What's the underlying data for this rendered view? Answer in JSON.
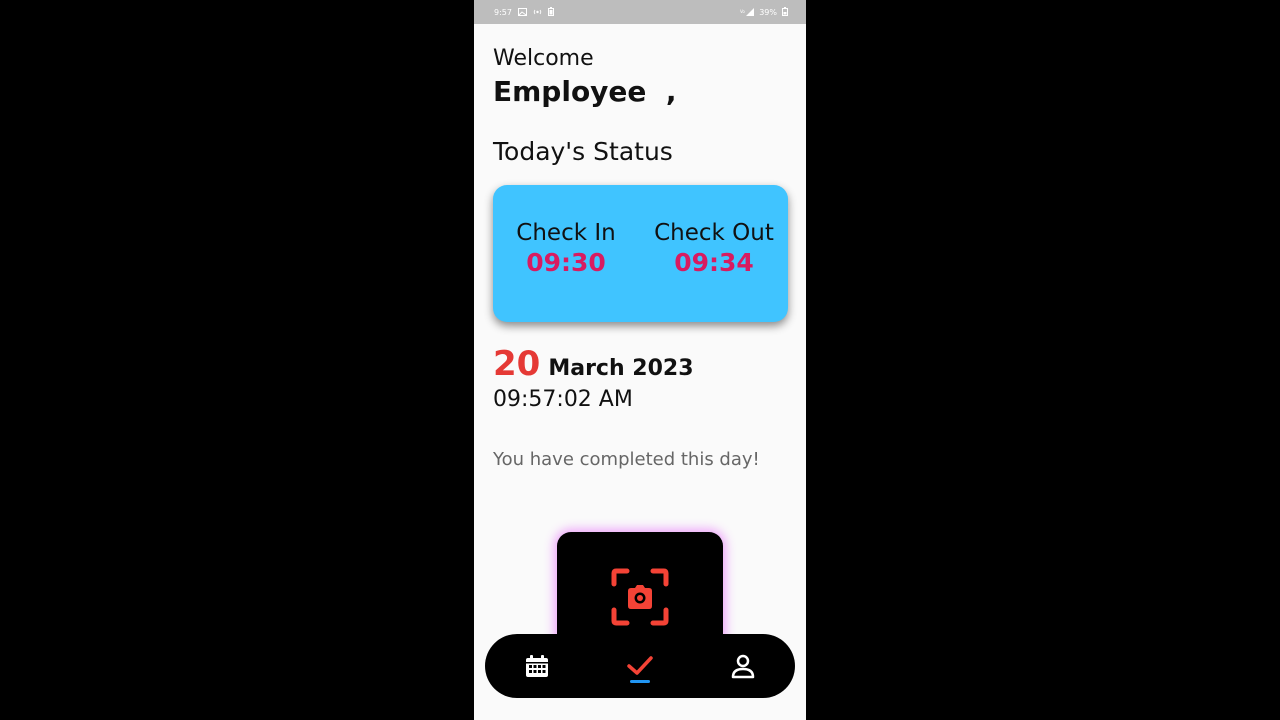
{
  "statusbar": {
    "time": "9:57",
    "battery_text": "39%"
  },
  "home": {
    "greeting": "Welcome",
    "user_name": "Employee  ,",
    "section_title": "Today's Status"
  },
  "status_card": {
    "check_in_label": "Check In",
    "check_in_time": "09:30",
    "check_out_label": "Check Out",
    "check_out_time": "09:34"
  },
  "date": {
    "day": "20",
    "month_year": "March 2023",
    "clock": "09:57:02 AM"
  },
  "message": "You have completed this day!",
  "colors": {
    "card_bg": "#40c4ff",
    "time_text": "#d81b60",
    "day_text": "#e53935",
    "scan_icon": "#f44336",
    "nav_active": "#f44336",
    "nav_indicator": "#2196f3",
    "glow": "#e040fb"
  },
  "icons": {
    "scan": "camera-scan-icon",
    "nav": [
      "calendar-icon",
      "check-icon",
      "person-icon"
    ]
  }
}
